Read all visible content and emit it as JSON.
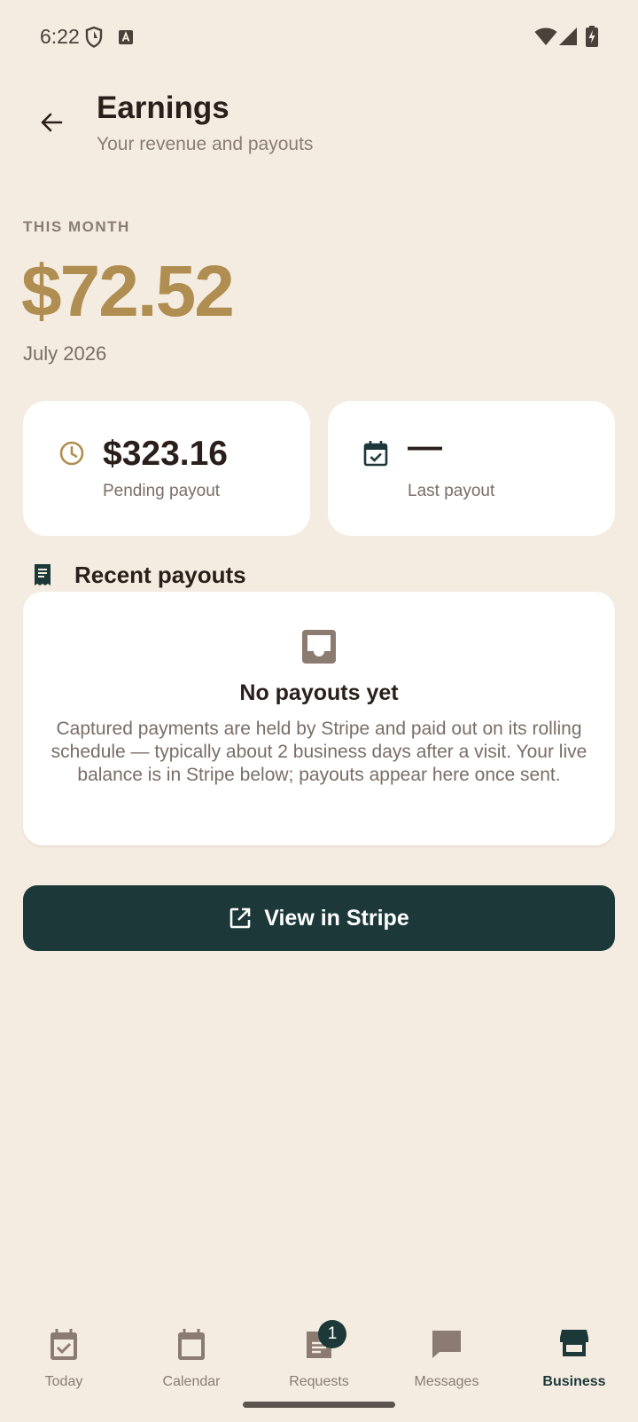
{
  "status_bar": {
    "time": "6:22"
  },
  "header": {
    "title": "Earnings",
    "subtitle": "Your revenue and payouts"
  },
  "summary": {
    "period_label": "THIS MONTH",
    "amount": "$72.52",
    "month": "July 2026"
  },
  "stats": {
    "pending": {
      "value": "$323.16",
      "label": "Pending payout",
      "icon": "clock-icon"
    },
    "last": {
      "value": "—",
      "label": "Last payout",
      "icon": "calendar-check-icon"
    }
  },
  "recent_payouts": {
    "title": "Recent payouts",
    "empty_title": "No payouts yet",
    "empty_body": "Captured payments are held by Stripe and paid out on its rolling schedule — typically about 2 business days after a visit. Your live balance is in Stripe below; payouts appear here once sent."
  },
  "stripe_button": {
    "label": "View in Stripe",
    "icon": "open-external-icon"
  },
  "nav": {
    "items": [
      {
        "label": "Today",
        "icon": "today-check-icon"
      },
      {
        "label": "Calendar",
        "icon": "calendar-icon"
      },
      {
        "label": "Requests",
        "icon": "requests-icon",
        "badge": "1"
      },
      {
        "label": "Messages",
        "icon": "message-icon"
      },
      {
        "label": "Business",
        "icon": "storefront-icon",
        "active": true
      }
    ]
  },
  "colors": {
    "background": "#f4ece1",
    "accent_gold": "#b08d50",
    "primary_dark": "#1c3839",
    "card": "#ffffff",
    "muted_text": "#8a7d72"
  }
}
